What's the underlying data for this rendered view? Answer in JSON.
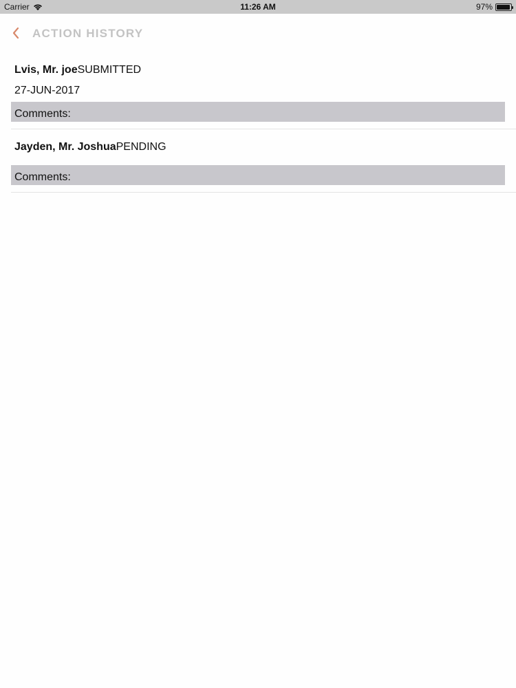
{
  "status_bar": {
    "carrier": "Carrier",
    "time": "11:26 AM",
    "battery_text": "97%",
    "battery_level": 0.97
  },
  "nav": {
    "title": "ACTION HISTORY",
    "accent_color": "#d8886a"
  },
  "history": [
    {
      "name": "Lvis, Mr. joe",
      "status": "SUBMITTED",
      "date": "27-JUN-2017",
      "comments_label": "Comments:"
    },
    {
      "name": "Jayden, Mr. Joshua",
      "status": "PENDING",
      "date": "",
      "comments_label": "Comments:"
    }
  ]
}
